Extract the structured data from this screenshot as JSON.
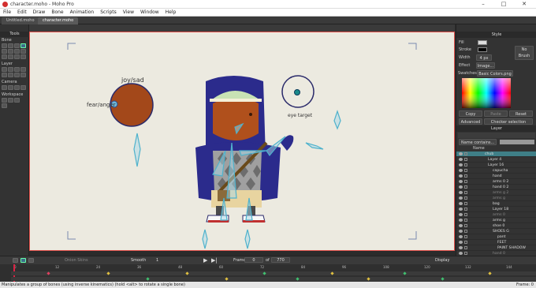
{
  "window": {
    "title": "character.moho - Moho Pro",
    "min": "–",
    "max": "□",
    "close": "✕"
  },
  "menu": [
    "File",
    "Edit",
    "Draw",
    "Bone",
    "Animation",
    "Scripts",
    "View",
    "Window",
    "Help"
  ],
  "tabs": [
    "Untitled.moho",
    "character.moho"
  ],
  "tools": {
    "title": "Tools",
    "groups": [
      "Bone",
      "Layer",
      "Camera",
      "Workspace"
    ]
  },
  "canvas": {
    "labels": {
      "joy_sad": "joy/sad",
      "fear_anger": "fear/anger",
      "eye_target": "eye target"
    },
    "colors": {
      "bg": "#eceae0",
      "head": "#b0501c",
      "hoodie": "#2b2b8c",
      "argyle": "#9a9a9a"
    }
  },
  "style": {
    "title": "Style",
    "fill_label": "Fill",
    "stroke_label": "Stroke",
    "width_label": "Width",
    "width_value": "4 px",
    "effect_label": "Effect",
    "effect_value": "Image...",
    "no_brush": "No Brush",
    "swatches_label": "Swatches",
    "swatches_value": "Basic Colors.png",
    "buttons": [
      "Copy",
      "Paste",
      "Reset"
    ],
    "advanced": "Advanced",
    "checker": "Checker selection"
  },
  "layers": {
    "title": "Layer",
    "filter": "Name contains...",
    "header": "Name",
    "rows": [
      {
        "name": "chub",
        "selected": true
      },
      {
        "name": "Layer 4"
      },
      {
        "name": "Layer 16"
      },
      {
        "name": "capucha"
      },
      {
        "name": "hand"
      },
      {
        "name": "arms 0 2"
      },
      {
        "name": "hand 0 2"
      },
      {
        "name": "arms g 2"
      },
      {
        "name": "arms g"
      },
      {
        "name": "bag"
      },
      {
        "name": "Layer 18"
      },
      {
        "name": "arms 0"
      },
      {
        "name": "arms g"
      },
      {
        "name": "shoe 0"
      },
      {
        "name": "SHOES G"
      },
      {
        "name": "pant"
      },
      {
        "name": "FEET"
      },
      {
        "name": "PAINT SHADOW"
      },
      {
        "name": "hand 0"
      },
      {
        "name": "hand 0 2"
      }
    ]
  },
  "timeline": {
    "smooth": "Smooth",
    "smooth_value": "1",
    "onion": "Onion Skins",
    "frame_label": "Frame",
    "frame_value": "0",
    "of": "of",
    "total": "770",
    "display": "Display",
    "ticks": [
      "0",
      "6",
      "12",
      "18",
      "24",
      "30",
      "36",
      "42",
      "48",
      "54",
      "60",
      "66",
      "72",
      "78",
      "84",
      "90",
      "96",
      "102",
      "108",
      "114",
      "120",
      "126",
      "132",
      "138",
      "144",
      "150",
      "156",
      "162",
      "168",
      "174",
      "180",
      "186",
      "192",
      "198",
      "204",
      "210",
      "216",
      "222",
      "228",
      "234",
      "240"
    ]
  },
  "status": {
    "message": "Manipulates a group of bones (using inverse kinematics) (hold <alt> to rotate a single bone)",
    "frame": "Frame: 0"
  }
}
